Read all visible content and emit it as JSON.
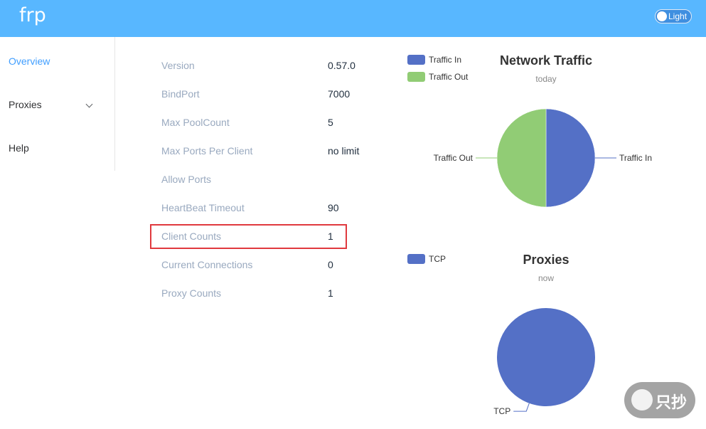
{
  "header": {
    "brand": "frp",
    "theme_toggle_label": "Light"
  },
  "sidebar": {
    "items": [
      {
        "label": "Overview",
        "active": true
      },
      {
        "label": "Proxies",
        "expandable": true
      },
      {
        "label": "Help"
      }
    ]
  },
  "server_info": [
    {
      "label": "Version",
      "value": "0.57.0"
    },
    {
      "label": "BindPort",
      "value": "7000"
    },
    {
      "label": "Max PoolCount",
      "value": "5"
    },
    {
      "label": "Max Ports Per Client",
      "value": "no limit"
    },
    {
      "label": "Allow Ports",
      "value": ""
    },
    {
      "label": "HeartBeat Timeout",
      "value": "90"
    },
    {
      "label": "Client Counts",
      "value": "1",
      "highlighted": true
    },
    {
      "label": "Current Connections",
      "value": "0"
    },
    {
      "label": "Proxy Counts",
      "value": "1"
    }
  ],
  "colors": {
    "header": "#58b7ff",
    "active_nav": "#409eff",
    "label": "#99a9bf",
    "highlight": "#e0393e",
    "series_blue": "#5470c6",
    "series_green": "#91cc75"
  },
  "chart_data": [
    {
      "type": "pie",
      "title": "Network Traffic",
      "subtitle": "today",
      "legend_position": "top-left",
      "categories": [
        "Traffic In",
        "Traffic Out"
      ],
      "values": [
        50,
        50
      ],
      "colors": [
        "#5470c6",
        "#91cc75"
      ]
    },
    {
      "type": "pie",
      "title": "Proxies",
      "subtitle": "now",
      "legend_position": "top-left",
      "categories": [
        "TCP"
      ],
      "values": [
        1
      ],
      "colors": [
        "#5470c6"
      ]
    }
  ],
  "watermark": {
    "text": "只抄",
    "logo": "husky-dog-icon"
  }
}
